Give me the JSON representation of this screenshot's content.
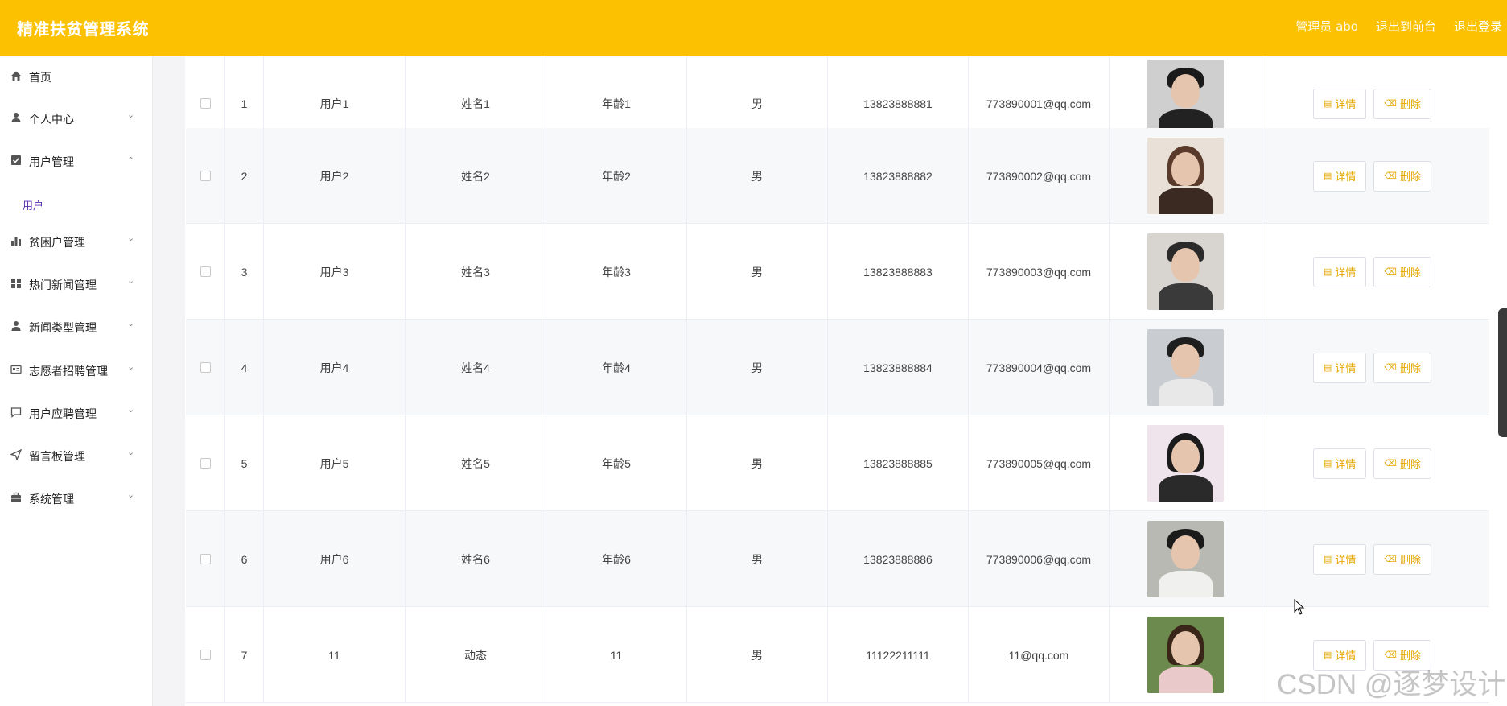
{
  "header": {
    "brand": "精准扶贫管理系统",
    "admin_label": "管理员 abo",
    "front_link": "退出到前台",
    "logout_link": "退出登录"
  },
  "sidebar": {
    "items": [
      {
        "label": "首页",
        "icon": "home-icon"
      },
      {
        "label": "个人中心",
        "icon": "user-icon"
      },
      {
        "label": "用户管理",
        "icon": "check-square-icon"
      },
      {
        "label": "贫困户管理",
        "icon": "bar-chart-icon"
      },
      {
        "label": "热门新闻管理",
        "icon": "grid-icon"
      },
      {
        "label": "新闻类型管理",
        "icon": "user-icon"
      },
      {
        "label": "志愿者招聘管理",
        "icon": "id-card-icon"
      },
      {
        "label": "用户应聘管理",
        "icon": "chat-icon"
      },
      {
        "label": "留言板管理",
        "icon": "send-icon"
      },
      {
        "label": "系统管理",
        "icon": "briefcase-icon"
      }
    ],
    "submenu": {
      "label": "用户"
    }
  },
  "table": {
    "rows": [
      {
        "index": "1",
        "account": "用户1",
        "name": "姓名1",
        "age": "年龄1",
        "gender": "男",
        "phone": "13823888881",
        "email": "773890001@qq.com"
      },
      {
        "index": "2",
        "account": "用户2",
        "name": "姓名2",
        "age": "年龄2",
        "gender": "男",
        "phone": "13823888882",
        "email": "773890002@qq.com"
      },
      {
        "index": "3",
        "account": "用户3",
        "name": "姓名3",
        "age": "年龄3",
        "gender": "男",
        "phone": "13823888883",
        "email": "773890003@qq.com"
      },
      {
        "index": "4",
        "account": "用户4",
        "name": "姓名4",
        "age": "年龄4",
        "gender": "男",
        "phone": "13823888884",
        "email": "773890004@qq.com"
      },
      {
        "index": "5",
        "account": "用户5",
        "name": "姓名5",
        "age": "年龄5",
        "gender": "男",
        "phone": "13823888885",
        "email": "773890005@qq.com"
      },
      {
        "index": "6",
        "account": "用户6",
        "name": "姓名6",
        "age": "年龄6",
        "gender": "男",
        "phone": "13823888886",
        "email": "773890006@qq.com"
      },
      {
        "index": "7",
        "account": "11",
        "name": "动态",
        "age": "11",
        "gender": "男",
        "phone": "11122211111",
        "email": "11@qq.com"
      }
    ],
    "detail_label": "详情",
    "delete_label": "删除"
  },
  "watermark": "CSDN @逐梦设计",
  "colors": {
    "accent": "#fcc100",
    "button_text": "#e6a700",
    "submenu": "#5b2fb0"
  }
}
